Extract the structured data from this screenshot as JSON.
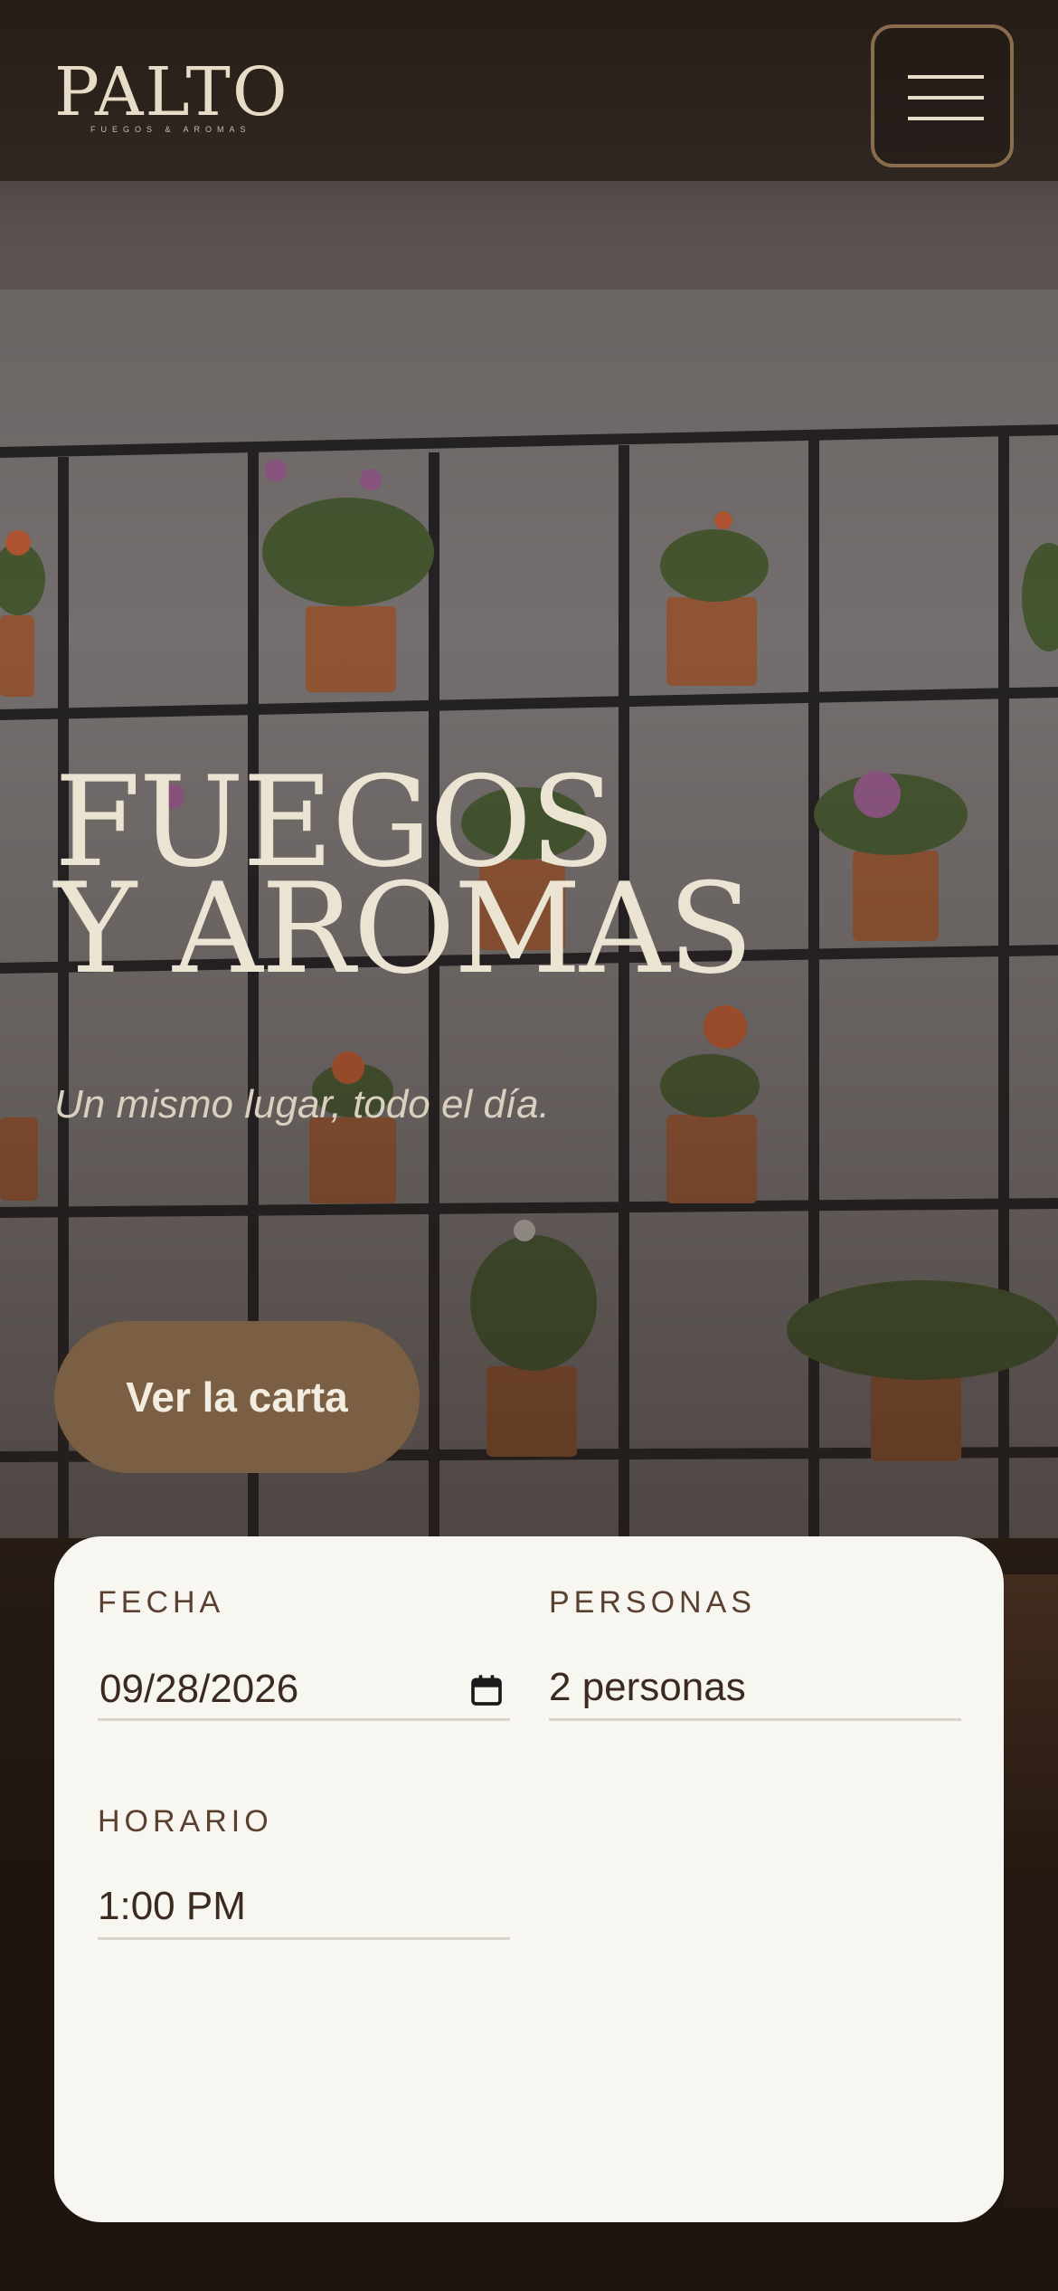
{
  "brand": {
    "name": "PALTO",
    "tagline": "FUEGOS & AROMAS"
  },
  "header": {
    "menu_icon": "hamburger-menu-icon"
  },
  "hero": {
    "title_line1": "FUEGOS",
    "title_line2": "Y AROMAS",
    "subtitle": "Un mismo lugar, todo el día.",
    "cta_label": "Ver la carta"
  },
  "reservation": {
    "date": {
      "label": "FECHA",
      "value": "09/28/2026",
      "icon": "calendar-icon"
    },
    "people": {
      "label": "PERSONAS",
      "value": "2 personas"
    },
    "time": {
      "label": "HORARIO",
      "value": "1:00 PM"
    }
  },
  "colors": {
    "accent": "#7a5f44",
    "menu_border": "#8a6d4c",
    "card_background": "#f8f6f0",
    "title_text": "#ece4d3",
    "field_text": "#3a2a20"
  }
}
